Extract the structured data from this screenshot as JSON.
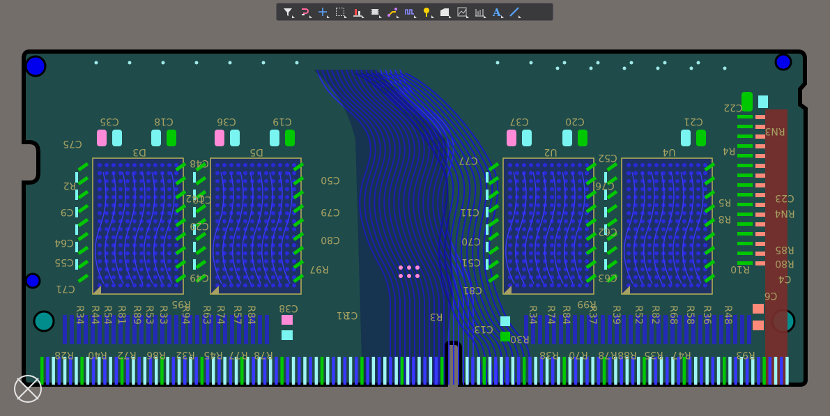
{
  "app": {
    "view": "PCB 2D layout"
  },
  "toolbar": {
    "items": [
      {
        "name": "filter-icon",
        "tooltip": "Filter"
      },
      {
        "name": "route-icon",
        "tooltip": "Interactive Routing"
      },
      {
        "name": "crosshair-icon",
        "tooltip": "Place"
      },
      {
        "name": "select-rect-icon",
        "tooltip": "Select"
      },
      {
        "name": "align-icon",
        "tooltip": "Align"
      },
      {
        "name": "component-icon",
        "tooltip": "Component"
      },
      {
        "name": "route-tool-icon",
        "tooltip": "Route"
      },
      {
        "name": "length-tune-icon",
        "tooltip": "Length Tuning"
      },
      {
        "name": "via-icon",
        "tooltip": "Via"
      },
      {
        "name": "polygon-icon",
        "tooltip": "Polygon"
      },
      {
        "name": "graph-icon",
        "tooltip": "Graph"
      },
      {
        "name": "dimension-icon",
        "tooltip": "Dimension"
      },
      {
        "name": "text-icon",
        "tooltip": "String"
      },
      {
        "name": "line-icon",
        "tooltip": "Line"
      }
    ]
  },
  "silkscreen": {
    "top_caps": [
      "C35",
      "C18",
      "C36",
      "C19",
      "C37",
      "C20",
      "C21"
    ],
    "chips": [
      "D3",
      "D5",
      "U2",
      "U4"
    ],
    "left_caps": [
      "C75",
      "R2",
      "C9",
      "C64",
      "C55",
      "C71"
    ],
    "mid_left": [
      "C50",
      "C79",
      "C80",
      "R97",
      "C38",
      "C49",
      "C48",
      "C10",
      "C29",
      "R95",
      "C42"
    ],
    "mid": [
      "R1",
      "C1",
      "R3",
      "C13",
      "R30",
      "C77",
      "C11",
      "C70",
      "C51",
      "C81",
      "R99",
      "C63",
      "C52",
      "C76",
      "C62"
    ],
    "right": [
      "C22",
      "RN3",
      "C23",
      "RN4",
      "R85",
      "R80",
      "C4",
      "R10",
      "R8",
      "R5",
      "C6",
      "R4"
    ],
    "bottom_row": [
      "R28",
      "R40",
      "R72",
      "R86",
      "R32",
      "R45",
      "R77",
      "R78",
      "R38",
      "R70",
      "R78",
      "R88",
      "R35",
      "R47",
      "R93"
    ],
    "row_labels": [
      "R34",
      "R44",
      "R54",
      "R81",
      "R89",
      "R53",
      "R33",
      "R94",
      "R63",
      "R74",
      "R57",
      "R84",
      "R34",
      "R74",
      "R84",
      "R37",
      "R39",
      "R52",
      "R82",
      "R68",
      "R58",
      "R36",
      "R48"
    ]
  },
  "colors": {
    "background": "#746e6b",
    "board": "#1f4c4a",
    "outline": "#000000",
    "traces": "#1a1ac8",
    "pads_pink": "#ff8ad8",
    "pads_cyan": "#7af4f0",
    "pads_green": "#00c800",
    "silk": "#a7a163",
    "toolbar": "#3a3a3d"
  }
}
